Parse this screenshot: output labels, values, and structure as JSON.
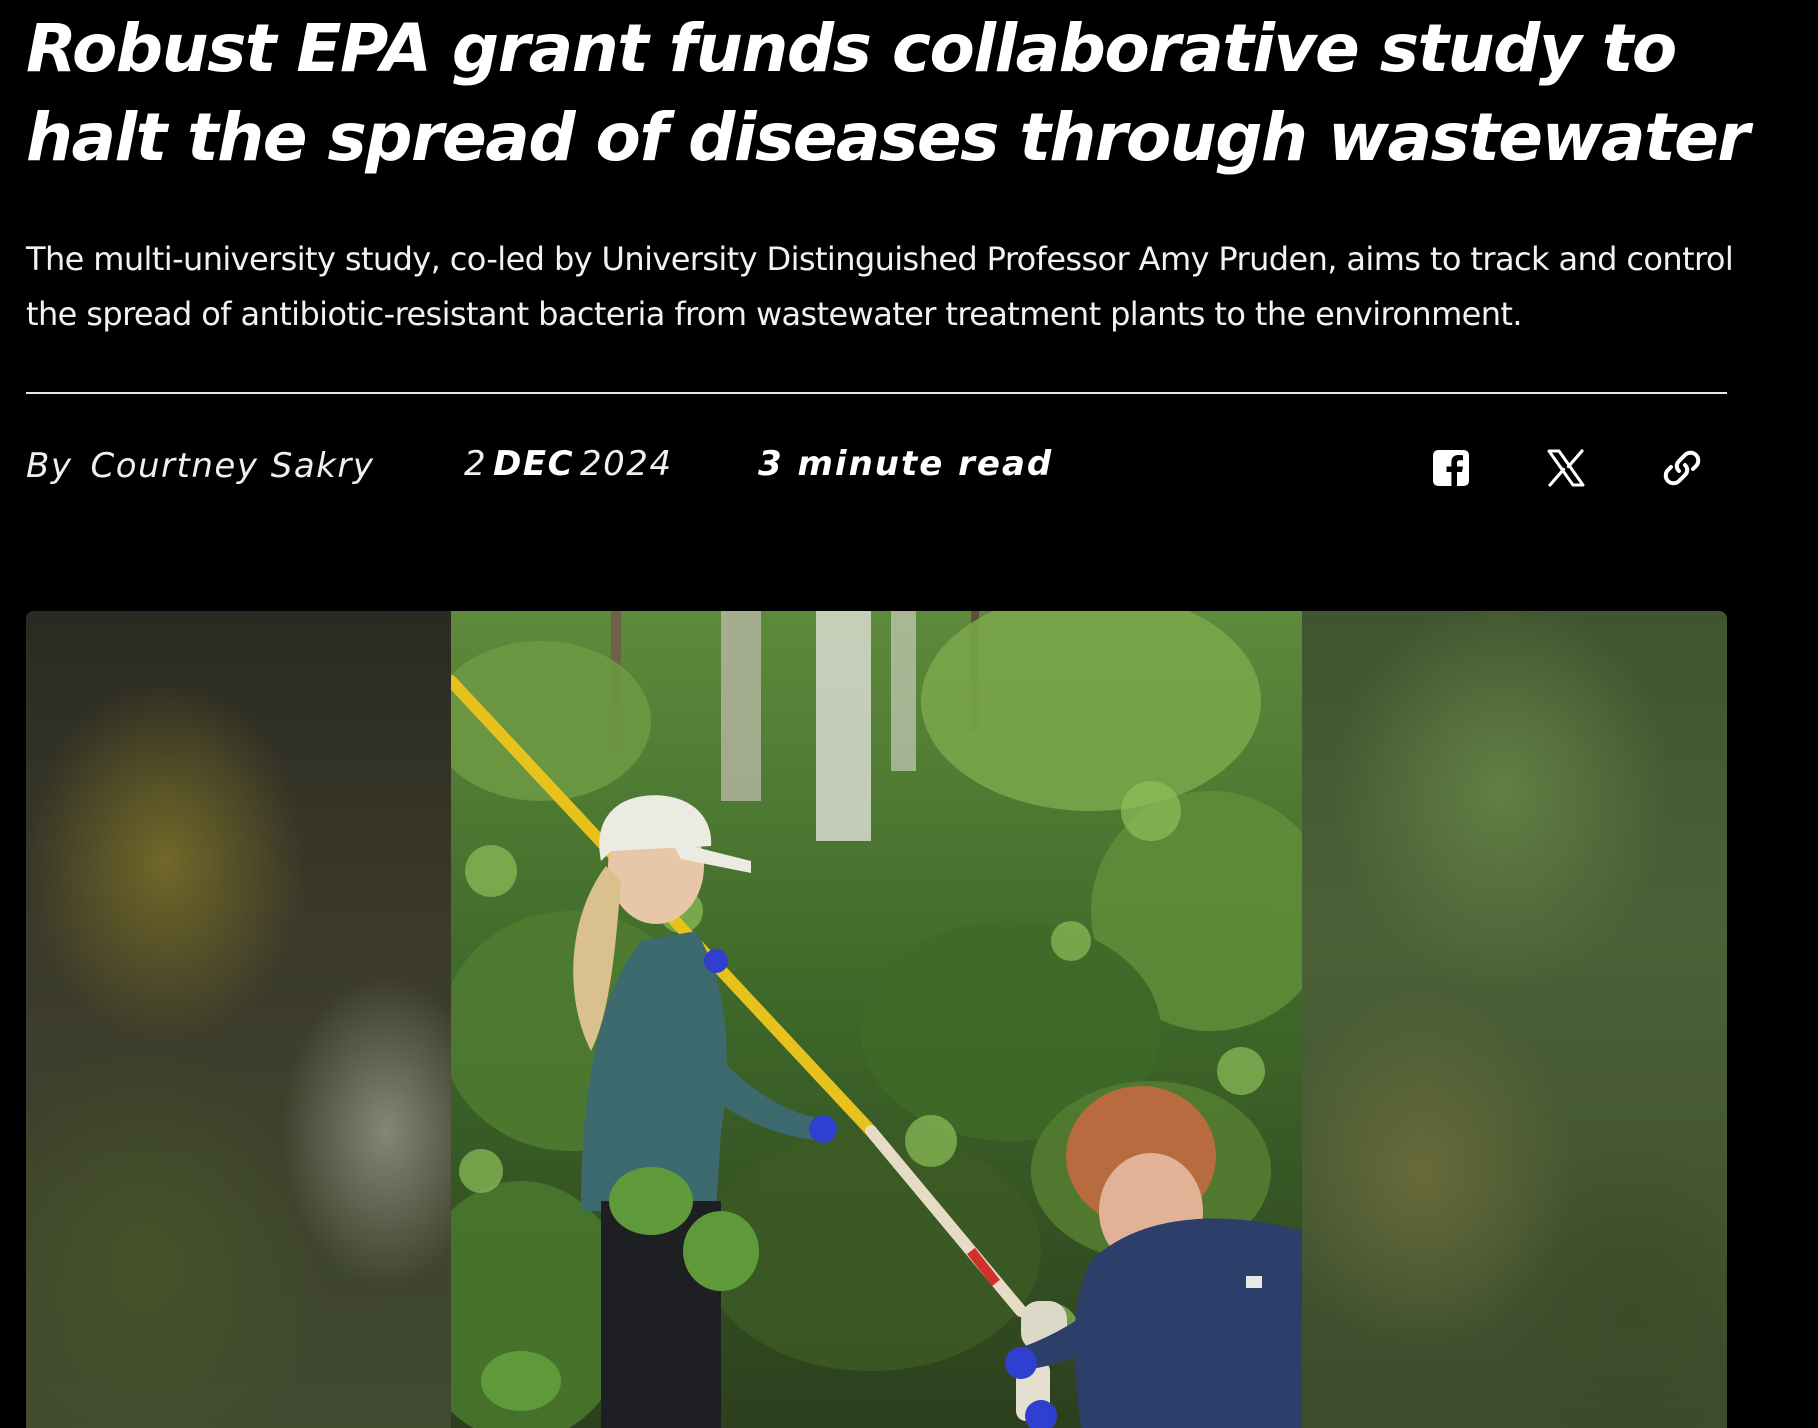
{
  "article": {
    "title": "Robust EPA grant funds collaborative study to halt the spread of diseases through wastewater",
    "subtitle": "The multi-university study, co-led by University Distinguished Professor Amy Pruden, aims to track and control the spread of antibiotic-resistant bacteria from wastewater treatment plants to the environment."
  },
  "meta": {
    "by_label": "By",
    "author": "Courtney Sakry",
    "date_day": "2",
    "date_month": "DEC",
    "date_year": "2024",
    "read_time": "3 minute read"
  },
  "share": {
    "icons": [
      "facebook-icon",
      "x-icon",
      "link-icon"
    ]
  },
  "hero": {
    "description_colors": {
      "foliage": "#3f6a2a",
      "pole": "#e8c21c",
      "shirt_left": "#3d6a6e",
      "shirt_right": "#2c3f6a",
      "gloves": "#2f3fd0"
    }
  }
}
